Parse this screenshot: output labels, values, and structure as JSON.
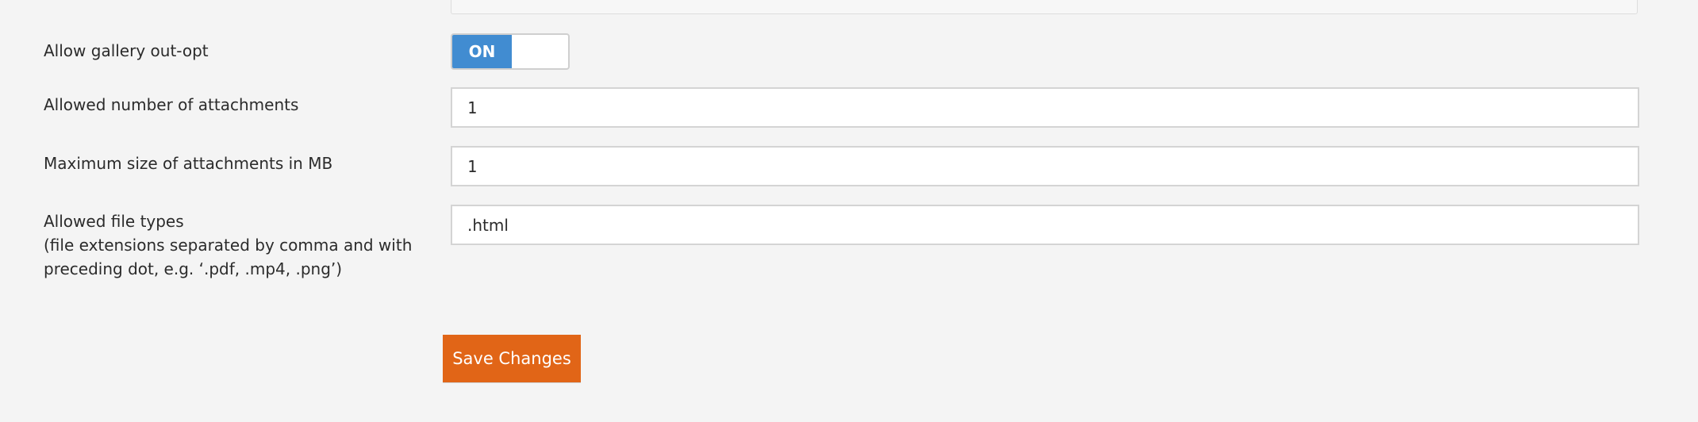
{
  "settings": {
    "gallery_opt_out": {
      "label": "Allow gallery out-opt",
      "toggle_label": "ON",
      "enabled": true
    },
    "attachments_count": {
      "label": "Allowed number of attachments",
      "value": "1"
    },
    "attachments_max_size": {
      "label": "Maximum size of attachments in MB",
      "value": "1"
    },
    "file_types": {
      "label_line1": "Allowed file types",
      "label_line2": "(file extensions separated by comma and with",
      "label_line3": "preceding dot, e.g. ‘.pdf, .mp4, .png’)",
      "value": ".html"
    }
  },
  "actions": {
    "save_label": "Save Changes"
  },
  "colors": {
    "toggle_on": "#418cd1",
    "save_button": "#e16517",
    "background": "#f4f4f4"
  }
}
